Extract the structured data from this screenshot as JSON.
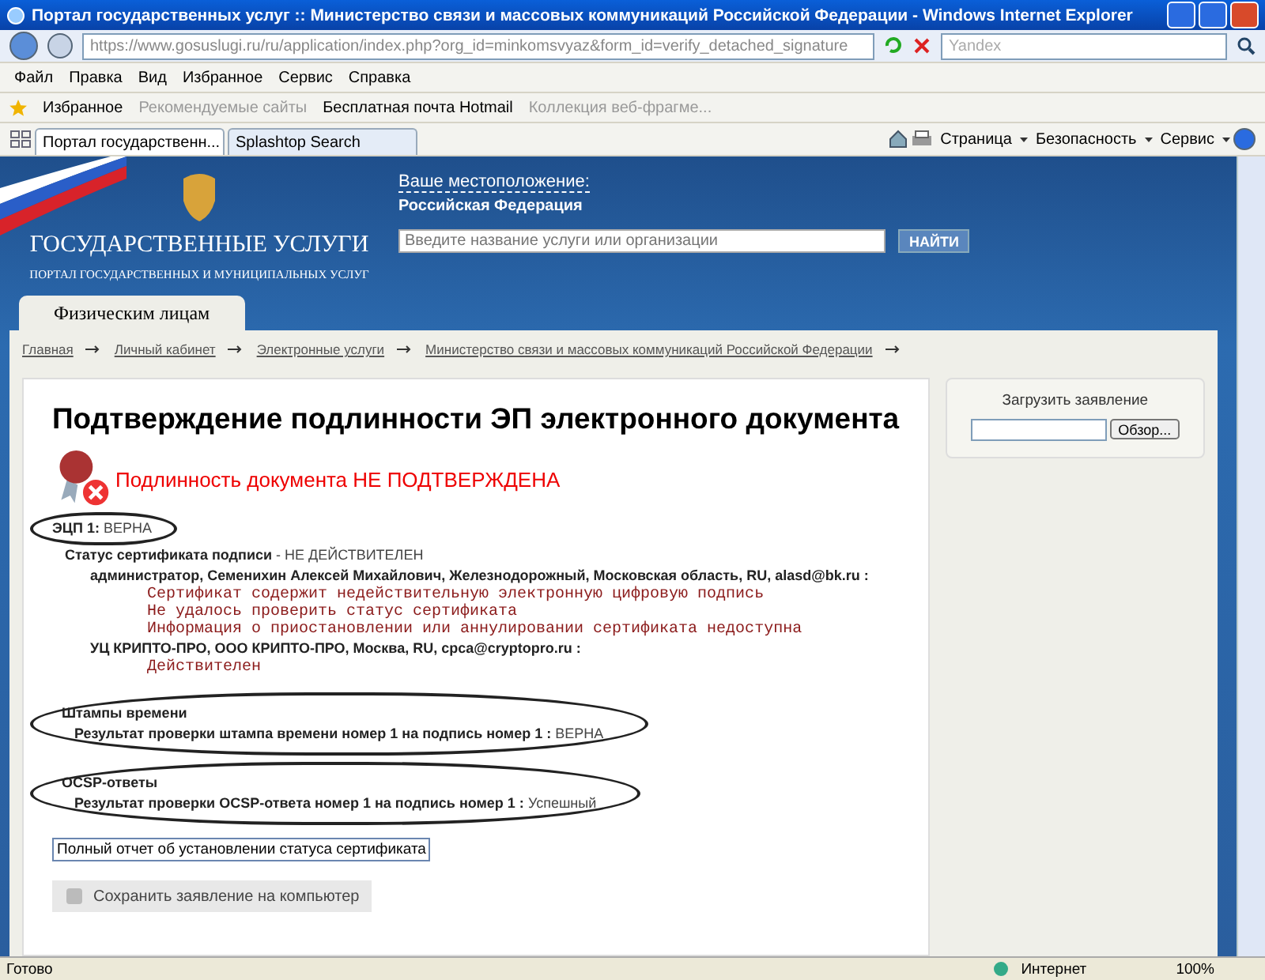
{
  "window": {
    "title": "Портал государственных услуг :: Министерство связи и массовых коммуникаций Российской Федерации - Windows Internet Explorer"
  },
  "address": {
    "url": "https://www.gosuslugi.ru/ru/application/index.php?org_id=minkomsvyaz&form_id=verify_detached_signature",
    "search_placeholder": "Yandex"
  },
  "menu": [
    "Файл",
    "Правка",
    "Вид",
    "Избранное",
    "Сервис",
    "Справка"
  ],
  "favorites": {
    "label": "Избранное",
    "links": [
      {
        "label": "Рекомендуемые сайты",
        "disabled": true
      },
      {
        "label": "Бесплатная почта Hotmail",
        "disabled": false
      },
      {
        "label": "Коллекция веб-фрагме...",
        "disabled": true
      }
    ]
  },
  "tabs": [
    {
      "label": "Портал государственн...",
      "selected": true
    },
    {
      "label": "Splashtop Search",
      "selected": false
    }
  ],
  "command_bar": [
    "Страница",
    "Безопасность",
    "Сервис"
  ],
  "header": {
    "logo_title": "ГОСУДАРСТВЕННЫЕ УСЛУГИ",
    "logo_subtitle": "ПОРТАЛ ГОСУДАРСТВЕННЫХ И МУНИЦИПАЛЬНЫХ УСЛУГ",
    "location_label": "Ваше местоположение:",
    "location": "Российская Федерация",
    "search_placeholder": "Введите название услуги или организации",
    "search_button": "НАЙТИ",
    "section_tab": "Физическим лицам"
  },
  "breadcrumbs": [
    "Главная",
    "Личный кабинет",
    "Электронные услуги",
    "Министерство связи и массовых коммуникаций Российской Федерации"
  ],
  "content": {
    "heading": "Подтверждение подлинности ЭП электронного документа",
    "verdict": "Подлинность документа НЕ ПОДТВЕРЖДЕНА",
    "signature": {
      "label": "ЭЦП 1:",
      "value": "ВЕРНА",
      "circled": true
    },
    "cert_status": {
      "label": "Статус сертификата подписи",
      "value": "- НЕ ДЕЙСТВИТЕЛЕН"
    },
    "certs": [
      {
        "owner": "администратор, Семенихин Алексей Михайлович, Железнодорожный, Московская область, RU, alasd@bk.ru :",
        "messages": [
          "Сертификат содержит недействительную электронную цифровую подпись",
          "Не удалось проверить статус сертификата",
          "Информация о приостановлении или аннулировании сертификата недоступна"
        ]
      },
      {
        "owner": "УЦ КРИПТО-ПРО, ООО КРИПТО-ПРО, Москва, RU, cpca@cryptopro.ru :",
        "messages": [
          "Действителен"
        ]
      }
    ],
    "sections": [
      {
        "title": "Штампы времени",
        "result": "Результат проверки штампа времени номер 1 на подпись номер 1 :",
        "value": "ВЕРНА",
        "circled": true
      },
      {
        "title": "OCSP-ответы",
        "result": "Результат проверки OCSP-ответа номер 1 на подпись номер 1 :",
        "value": "Успешный",
        "circled": true
      }
    ],
    "report_button": "Полный отчет об установлении статуса сертификата",
    "save_button": "Сохранить заявление на компьютер"
  },
  "upload": {
    "title": "Загрузить заявление",
    "browse_button": "Обзор..."
  },
  "status_bar": {
    "status": "Готово",
    "zone": "Интернет",
    "zoom": "100%"
  }
}
